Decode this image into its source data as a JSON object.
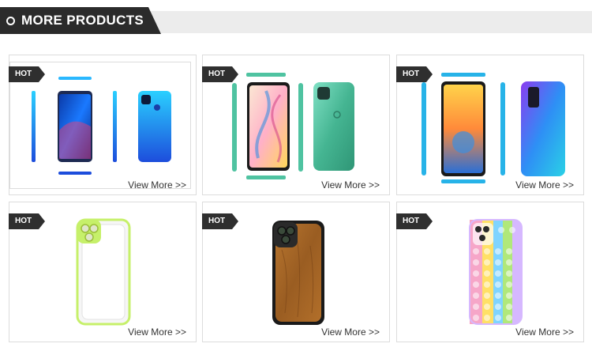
{
  "section": {
    "title": "MORE PRODUCTS"
  },
  "products": [
    {
      "tag": "HOT",
      "link_label": "View More >>",
      "image": "blue-smartphone-front-back-sides",
      "color": "#1f6bff"
    },
    {
      "tag": "HOT",
      "link_label": "View More >>",
      "image": "green-smartphone-front-back-sides",
      "color": "#5fc9a8"
    },
    {
      "tag": "HOT",
      "link_label": "View More >>",
      "image": "cyan-smartphone-front-back-sides",
      "color": "#27b3e8"
    },
    {
      "tag": "HOT",
      "link_label": "View More >>",
      "image": "clear-phone-case-green-bumper",
      "color": "#c6f06a"
    },
    {
      "tag": "HOT",
      "link_label": "View More >>",
      "image": "wood-grain-phone-case",
      "color": "#a9682c"
    },
    {
      "tag": "HOT",
      "link_label": "View More >>",
      "image": "rainbow-pop-bubble-phone-case",
      "color": "#f6a6c8"
    }
  ]
}
